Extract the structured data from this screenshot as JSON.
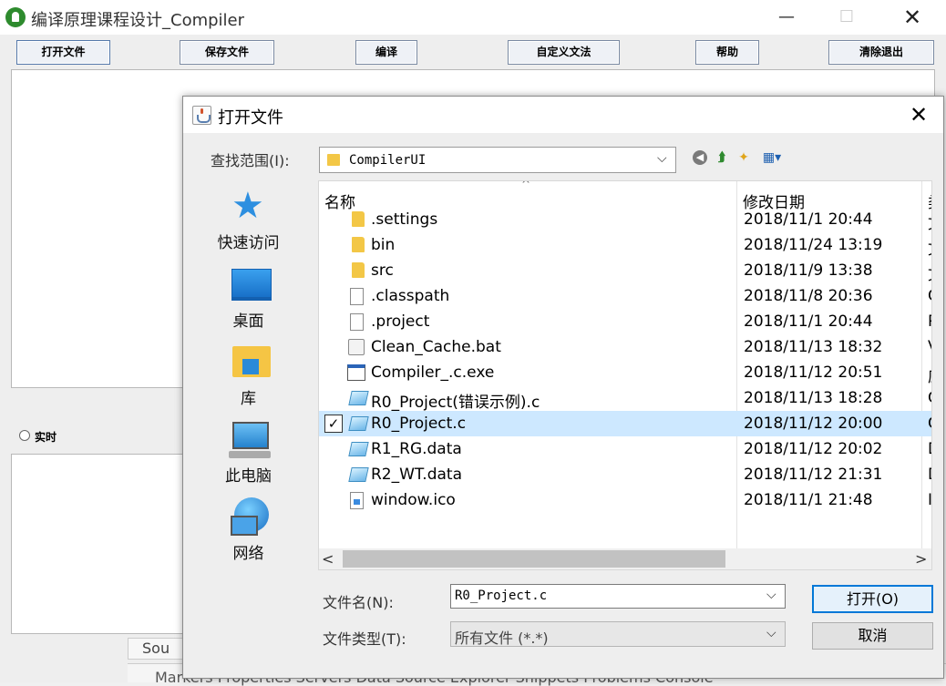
{
  "main_window": {
    "title": "编译原理课程设计_Compiler",
    "controls": {
      "minimize": "—",
      "maximize": "☐",
      "close": "✕"
    },
    "toolbar": {
      "open_file": "打开文件",
      "save_file": "保存文件",
      "compile": "编译",
      "custom_grammar": "自定义文法",
      "help": "帮助",
      "clear_exit": "清除退出"
    },
    "realtime_label": "实时"
  },
  "background_app": {
    "tab_fragment": "Sou",
    "views_strip": "Markers   Properties   Servers   Data Source Explorer   Snippets   Problems   Console"
  },
  "dialog": {
    "title": "打开文件",
    "close": "✕",
    "look_in_label": "查找范围(I):",
    "look_in_value": "CompilerUI",
    "chevron": "⌵",
    "toolbar_icons": [
      "back-icon",
      "up-folder-icon",
      "new-folder-icon",
      "view-menu-icon"
    ],
    "toolbar_glyphs": {
      "back": "◀",
      "up": "⮭",
      "new_folder": "✦",
      "view": "▦▾"
    },
    "places": {
      "quick_access": "快速访问",
      "desktop": "桌面",
      "library": "库",
      "this_pc": "此电脑",
      "network": "网络",
      "star_glyph": "★"
    },
    "columns": {
      "name": "名称",
      "modified": "修改日期",
      "type": "类",
      "sort_arrow": "^"
    },
    "files": [
      {
        "name": ".settings",
        "modified": "2018/11/1 20:44",
        "type": "文",
        "icon": "folder",
        "selected": false
      },
      {
        "name": "bin",
        "modified": "2018/11/24 13:19",
        "type": "文",
        "icon": "folder",
        "selected": false
      },
      {
        "name": "src",
        "modified": "2018/11/9 13:38",
        "type": "文",
        "icon": "folder",
        "selected": false
      },
      {
        "name": ".classpath",
        "modified": "2018/11/8 20:36",
        "type": "C",
        "icon": "doc",
        "selected": false
      },
      {
        "name": ".project",
        "modified": "2018/11/1 20:44",
        "type": "P",
        "icon": "doc",
        "selected": false
      },
      {
        "name": "Clean_Cache.bat",
        "modified": "2018/11/13 18:32",
        "type": "V",
        "icon": "bat",
        "selected": false
      },
      {
        "name": "Compiler_.c.exe",
        "modified": "2018/11/12 20:51",
        "type": "应",
        "icon": "exe",
        "selected": false
      },
      {
        "name": "R0_Project(错误示例).c",
        "modified": "2018/11/13 18:28",
        "type": "C",
        "icon": "cfile",
        "selected": false
      },
      {
        "name": "R0_Project.c",
        "modified": "2018/11/12 20:00",
        "type": "C",
        "icon": "cfile",
        "selected": true
      },
      {
        "name": "R1_RG.data",
        "modified": "2018/11/12 20:02",
        "type": "D",
        "icon": "data",
        "selected": false
      },
      {
        "name": "R2_WT.data",
        "modified": "2018/11/12 21:31",
        "type": "D",
        "icon": "data",
        "selected": false
      },
      {
        "name": "window.ico",
        "modified": "2018/11/1 21:48",
        "type": "Ic",
        "icon": "ico",
        "selected": false
      }
    ],
    "check_glyph": "✓",
    "scroll": {
      "left": "<",
      "right": ">"
    },
    "filename_label": "文件名(N):",
    "filename_value": "R0_Project.c",
    "filetype_label": "文件类型(T):",
    "filetype_value": "所有文件 (*.*)",
    "open_button": "打开(O)",
    "cancel_button": "取消"
  },
  "colors": {
    "selection": "#cde8ff",
    "accent_border": "#0078d7",
    "folder": "#f3c746"
  }
}
